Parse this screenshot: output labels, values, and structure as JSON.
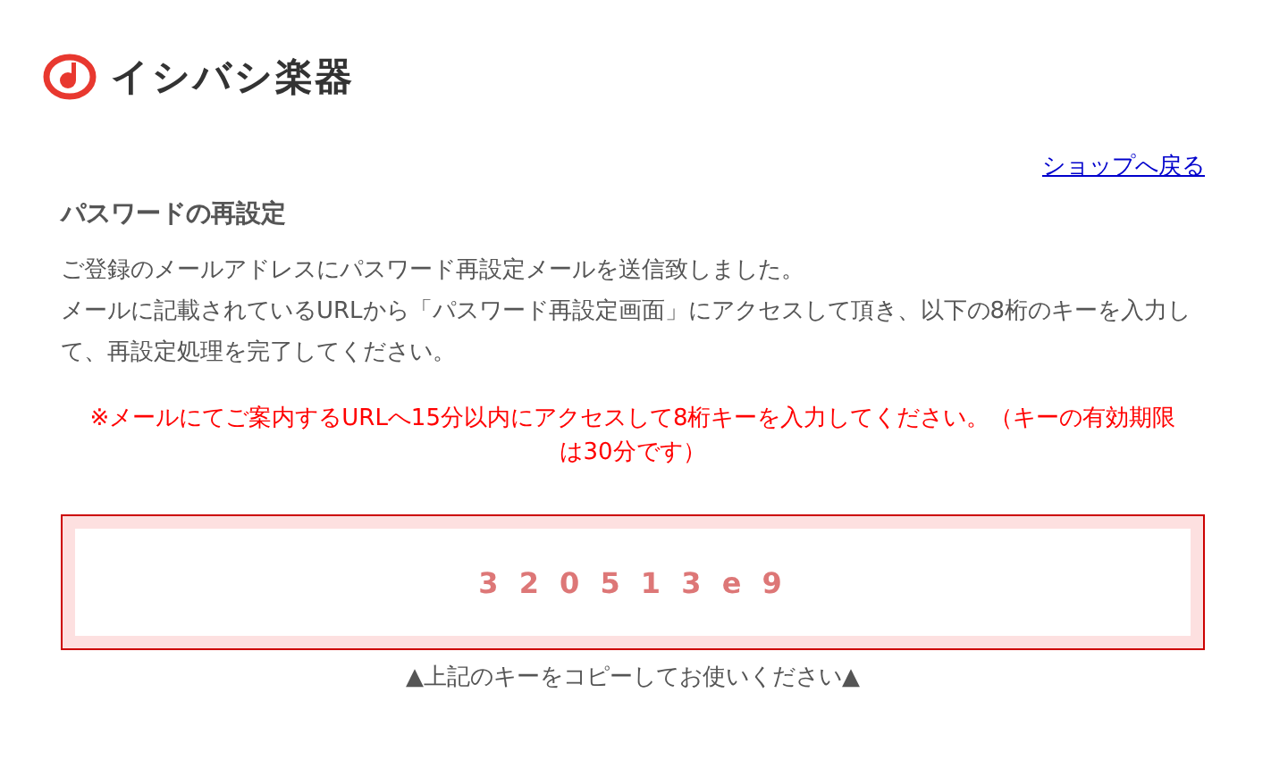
{
  "logo": {
    "text": "イシバシ楽器"
  },
  "back_link": "ショップへ戻る",
  "heading": "パスワードの再設定",
  "message_lines": [
    "ご登録のメールアドレスにパスワード再設定メールを送信致しました。",
    "メールに記載されているURLから「パスワード再設定画面」にアクセスして頂き、以下の8桁のキーを入力して、再設定処理を完了してください。"
  ],
  "notice": "※メールにてご案内するURLへ15分以内にアクセスして8桁キーを入力してください。（キーの有効期限は30分です）",
  "key": "3 2 0 5 1 3 e 9",
  "key_caption": "▲上記のキーをコピーしてお使いください▲"
}
